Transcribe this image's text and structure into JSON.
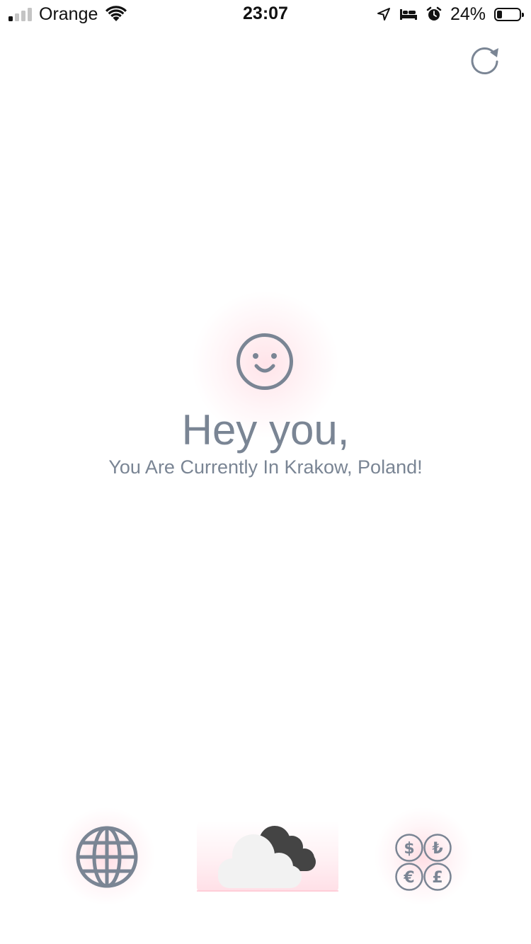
{
  "status_bar": {
    "carrier": "Orange",
    "time": "23:07",
    "battery_percent": "24%",
    "battery_level": 0.24,
    "signal_bars_active": 1,
    "signal_bars_total": 4
  },
  "header": {
    "refresh_icon": "refresh-icon"
  },
  "main": {
    "icon": "smile-icon",
    "greeting": "Hey you,",
    "location_text": "You Are Currently In Krakow, Poland!"
  },
  "bottom_nav": {
    "items": [
      {
        "icon": "globe-icon",
        "active": false
      },
      {
        "icon": "weather-cloud-icon",
        "active": true
      },
      {
        "icon": "currency-icon",
        "active": false
      }
    ]
  },
  "colors": {
    "text_gray": "#7a8594",
    "glow_pink": "#ffd0d8",
    "cloud_light": "#f2f2f2",
    "cloud_dark": "#444444"
  }
}
